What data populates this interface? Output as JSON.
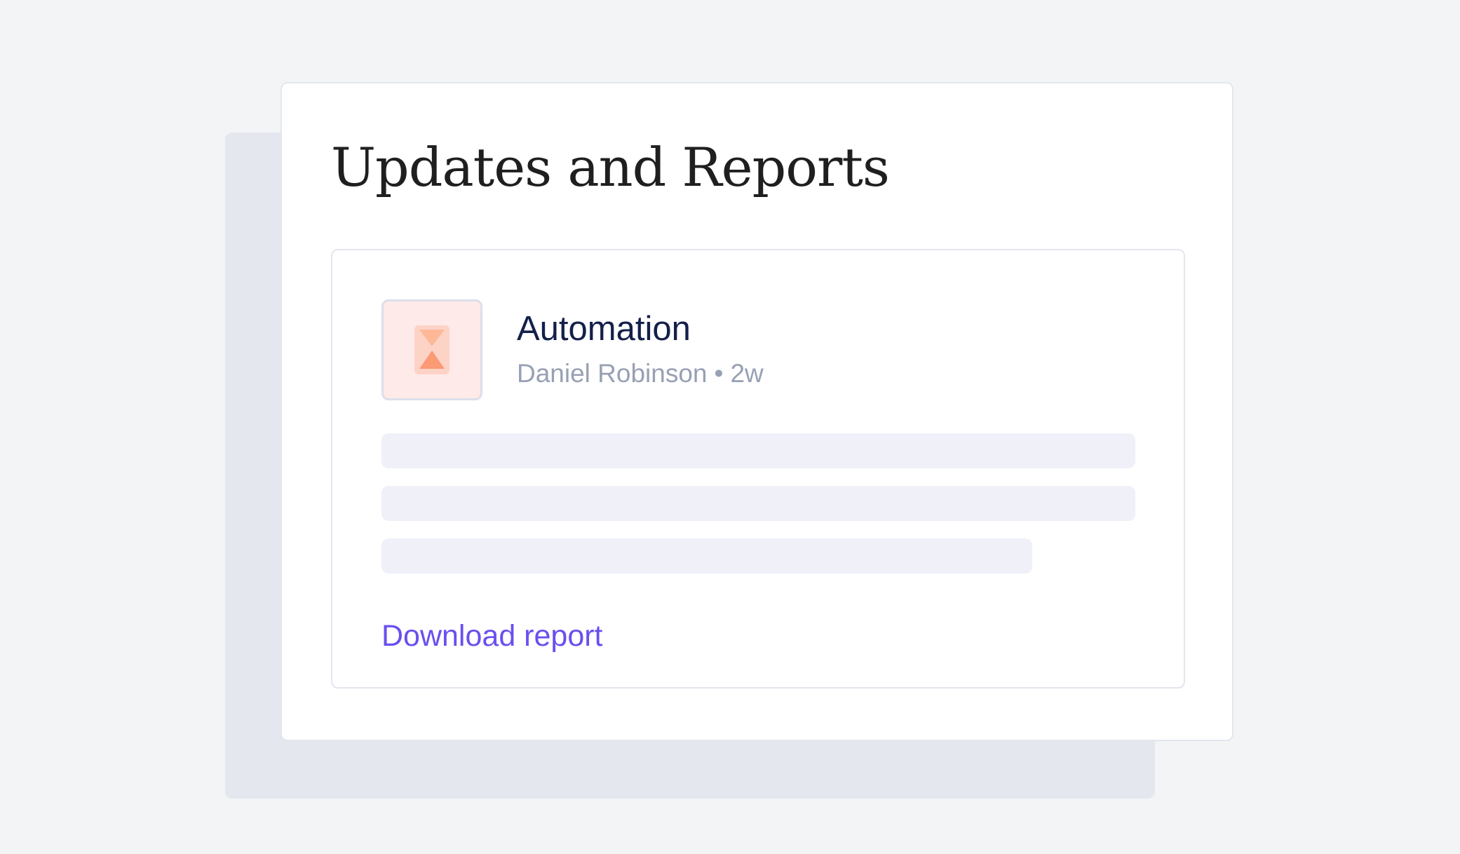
{
  "page": {
    "title": "Updates and Reports"
  },
  "report": {
    "icon": "hourglass-icon",
    "title": "Automation",
    "author": "Daniel Robinson",
    "separator": "•",
    "age": "2w",
    "download_label": "Download report"
  },
  "colors": {
    "background": "#f3f4f6",
    "card": "#ffffff",
    "accent_link": "#6a4ff0",
    "title_text": "#1f1f1f",
    "report_title": "#14204a",
    "meta_text": "#98a0b4",
    "skeleton": "#eff0f8",
    "icon_tile_bg": "#feeae8",
    "icon_orange": "#fb9a74"
  }
}
